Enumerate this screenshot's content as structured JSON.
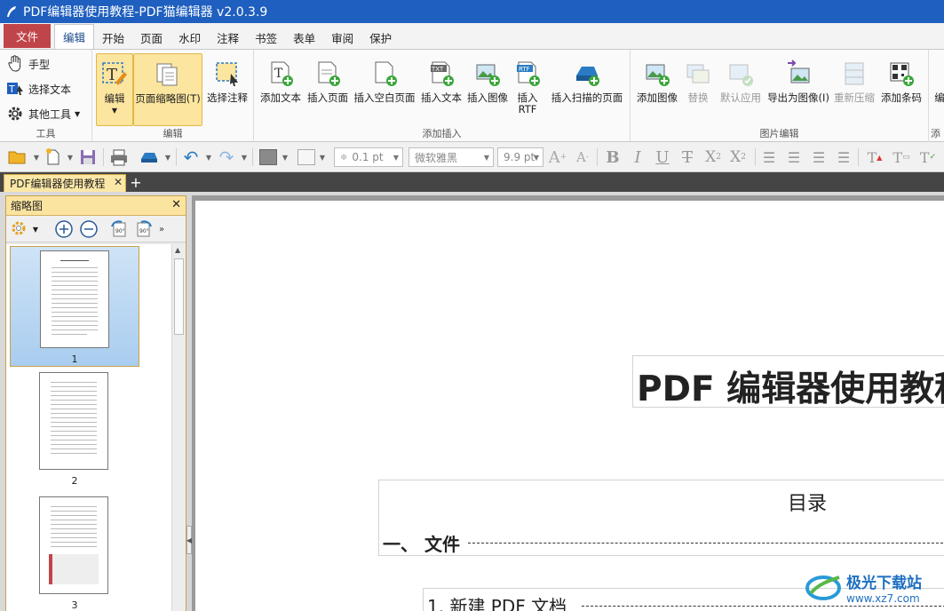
{
  "window": {
    "title": "PDF编辑器使用教程-PDF猫编辑器 v2.0.3.9"
  },
  "ribbon_tabs": [
    {
      "label": "文件"
    },
    {
      "label": "编辑"
    },
    {
      "label": "开始"
    },
    {
      "label": "页面"
    },
    {
      "label": "水印"
    },
    {
      "label": "注释"
    },
    {
      "label": "书签"
    },
    {
      "label": "表单"
    },
    {
      "label": "审阅"
    },
    {
      "label": "保护"
    }
  ],
  "ribbon": {
    "tools_group": {
      "label": "工具",
      "hand": "手型",
      "select_text": "选择文本",
      "other_tools": "其他工具"
    },
    "edit_group": {
      "label": "编辑",
      "edit": "编辑",
      "page_thumbs": "页面缩略图(T)",
      "select_annot": "选择注释"
    },
    "insert_group": {
      "label": "添加插入",
      "add_text": "添加文本",
      "insert_page": "插入页面",
      "insert_blank": "插入空白页面",
      "insert_text": "插入文本",
      "insert_image": "插入图像",
      "insert_rtf": "插入\nRTF",
      "insert_scan": "插入扫描的页面"
    },
    "image_group": {
      "label": "图片编辑",
      "add_image": "添加图像",
      "replace": "替换",
      "default_apply": "默认应用",
      "export_image": "导出为图像(I)",
      "recompress": "重新压缩",
      "add_barcode": "添加条码"
    },
    "cut_group": {
      "label": "添",
      "cut_btn": "编"
    }
  },
  "quick_toolbar": {
    "line_width": "0.1 pt",
    "font_name": "微软雅黑",
    "font_size": "9.9 pt"
  },
  "doc_tab": {
    "label": "PDF编辑器使用教程"
  },
  "thumb_pane": {
    "title": "缩略图",
    "pages": [
      "1",
      "2",
      "3"
    ]
  },
  "document": {
    "title": "PDF 编辑器使用教程",
    "toc_heading": "目录",
    "toc_section": "一、  文件",
    "toc_item": "1. 新建 PDF 文档"
  },
  "watermark": {
    "name": "极光下载站",
    "url": "www.xz7.com"
  },
  "colors": {
    "titlebar": "#1f5fbf",
    "file_tab": "#c0454b",
    "selection": "#fce59e"
  }
}
